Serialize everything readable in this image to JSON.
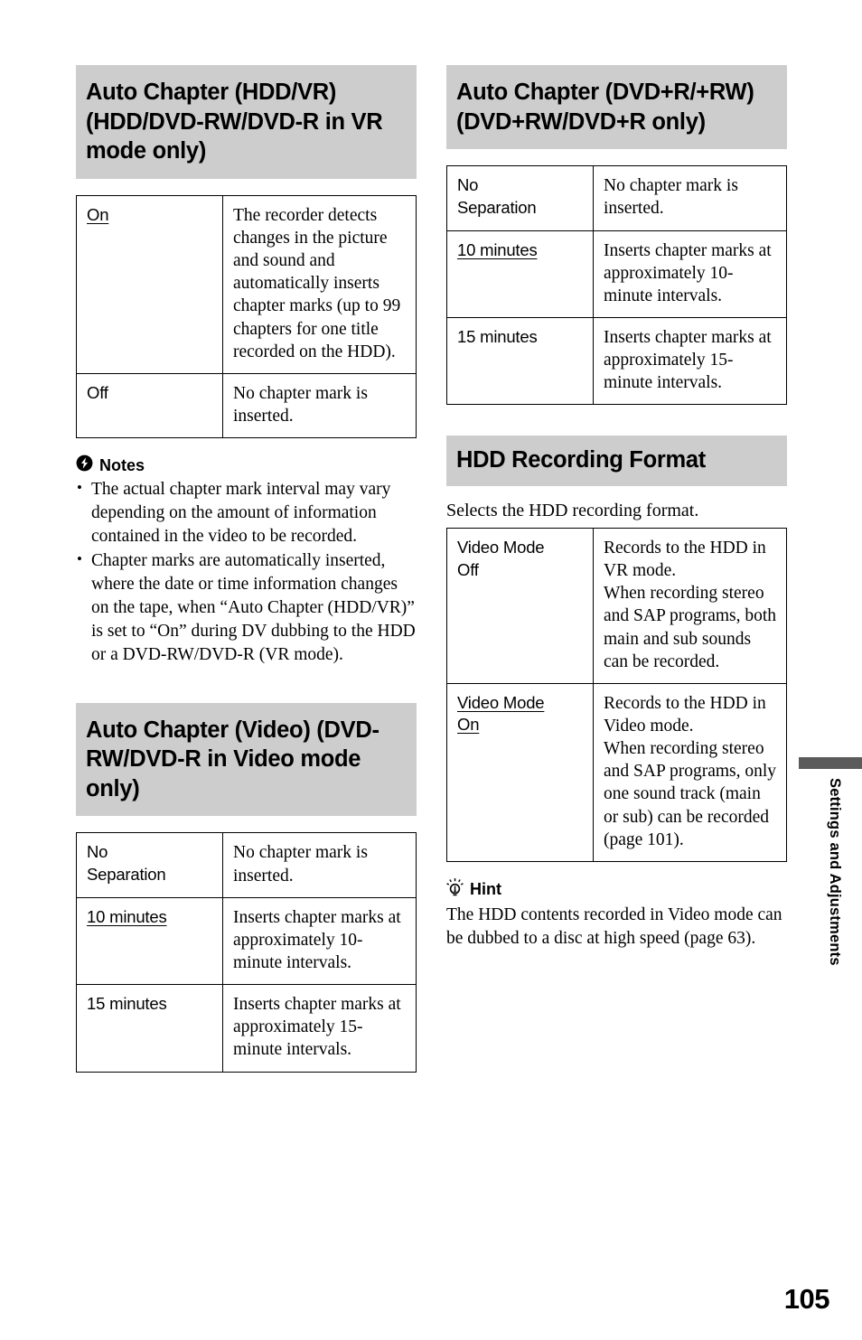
{
  "page": {
    "number": "105",
    "side_tab": "Settings and Adjustments"
  },
  "left_column": {
    "section1": {
      "heading": "Auto Chapter (HDD/VR) (HDD/DVD-RW/DVD-R in VR mode only)",
      "table": {
        "rows": [
          {
            "option": "On",
            "option_underlined": true,
            "description": "The recorder detects changes in the picture and sound and automatically inserts chapter marks (up to 99 chapters for one title recorded on the HDD)."
          },
          {
            "option": "Off",
            "option_underlined": false,
            "description": "No chapter mark is inserted."
          }
        ]
      },
      "notes": {
        "icon": "notes-bolt-icon",
        "title": "Notes",
        "items": [
          "The actual chapter mark interval may vary depending on the amount of information contained in the video to be recorded.",
          "Chapter marks are automatically inserted, where the date or time information changes on the tape, when “Auto Chapter (HDD/VR)” is set to “On” during DV dubbing to the HDD or a DVD-RW/DVD-R (VR mode)."
        ]
      }
    },
    "section2": {
      "heading": "Auto Chapter (Video) (DVD-RW/DVD-R in Video mode only)",
      "table": {
        "rows": [
          {
            "option_lines": [
              "No",
              "Separation"
            ],
            "option_underlined": false,
            "description": "No chapter mark is inserted."
          },
          {
            "option_lines": [
              "10 minutes"
            ],
            "option_underlined": true,
            "description": "Inserts chapter marks at approximately 10-minute intervals."
          },
          {
            "option_lines": [
              "15 minutes"
            ],
            "option_underlined": false,
            "description": "Inserts chapter marks at approximately 15-minute intervals."
          }
        ]
      }
    }
  },
  "right_column": {
    "section1": {
      "heading": "Auto Chapter (DVD+R/+RW) (DVD+RW/DVD+R only)",
      "table": {
        "rows": [
          {
            "option_lines": [
              "No",
              "Separation"
            ],
            "option_underlined": false,
            "description": "No chapter mark is inserted."
          },
          {
            "option_lines": [
              "10 minutes"
            ],
            "option_underlined": true,
            "description": "Inserts chapter marks at approximately 10-minute intervals."
          },
          {
            "option_lines": [
              "15 minutes"
            ],
            "option_underlined": false,
            "description": "Inserts chapter marks at approximately 15-minute intervals."
          }
        ]
      }
    },
    "section2": {
      "heading": "HDD Recording Format",
      "intro": "Selects the HDD recording format.",
      "table": {
        "rows": [
          {
            "option_lines": [
              "Video Mode",
              "Off"
            ],
            "option_underlined": false,
            "description": "Records to the HDD in VR mode.\nWhen recording stereo and SAP programs, both main and sub sounds can be recorded."
          },
          {
            "option_lines": [
              "Video Mode",
              "On"
            ],
            "option_underlined": true,
            "description": "Records to the HDD in Video mode.\nWhen recording stereo and SAP programs, only one sound track (main or sub) can be recorded\n(page 101)."
          }
        ]
      },
      "hint": {
        "icon": "hint-lightbulb-icon",
        "title": "Hint",
        "text": "The HDD contents recorded in Video mode can be dubbed to a disc at high speed (page 63)."
      }
    }
  },
  "colors": {
    "heading_band": "#cdcdcd",
    "edge_tab_bar": "#5b5b5b",
    "text": "#000000"
  }
}
